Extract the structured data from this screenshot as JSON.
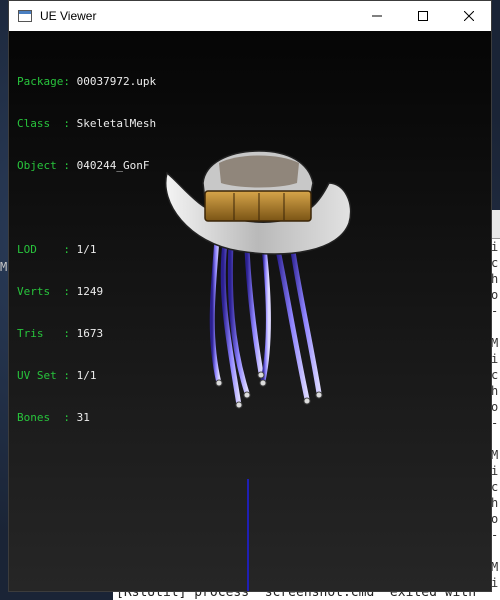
{
  "window": {
    "title": "UE Viewer",
    "app_icon": "window-icon",
    "controls": [
      "minimize-icon",
      "maximize-icon",
      "close-icon"
    ]
  },
  "info": {
    "package_label": "Package: ",
    "package_value": "00037972.upk",
    "class_label": "Class  : ",
    "class_value": "SkeletalMesh",
    "object_label": "Object : ",
    "object_value": "040244_GonF",
    "lod_label": "LOD    : ",
    "lod_value": "1/1",
    "verts_label": "Verts  : ",
    "verts_value": "1249",
    "tris_label": "Tris   : ",
    "tris_value": "1673",
    "uvset_label": "UV Set : ",
    "uvset_value": "1/1",
    "bones_label": "Bones  : ",
    "bones_value": "31"
  },
  "background": {
    "left_letter": "M",
    "terminal_lines": [
      "i",
      "c",
      "h",
      "o",
      "-",
      "",
      "M",
      "i",
      "c",
      "h",
      "o",
      "-",
      "",
      "M",
      "i",
      "c",
      "h",
      "o",
      "-",
      "",
      "M",
      "i"
    ],
    "status_text": "[RstUtil] process \"screenshot.cmd\" exited with"
  },
  "colors": {
    "label_green": "#28c43c",
    "value_white": "#ececec",
    "axis_blue": "#1f1fb3"
  }
}
